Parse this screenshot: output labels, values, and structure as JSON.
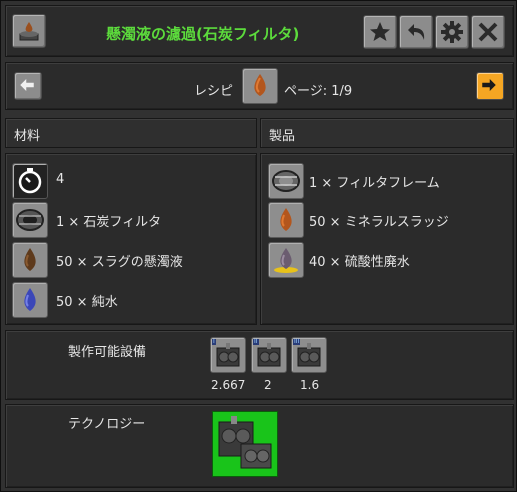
{
  "header": {
    "title": "懸濁液の濾過(石炭フィルタ)",
    "icon": "slurry-filter-recipe-icon",
    "buttons": [
      "star-icon",
      "back-icon",
      "gear-icon",
      "close-icon"
    ]
  },
  "nav": {
    "recipe_label": "レシピ",
    "page_label": "ページ: 1/9",
    "recipe_icon": "mineral-sludge-icon"
  },
  "ingredients": {
    "heading": "材料",
    "items": [
      {
        "icon": "time-icon",
        "text": "4"
      },
      {
        "icon": "coal-filter-icon",
        "text": "1 × 石炭フィルタ"
      },
      {
        "icon": "slag-slurry-icon",
        "text": "50 × スラグの懸濁液"
      },
      {
        "icon": "pure-water-icon",
        "text": "50 × 純水"
      }
    ]
  },
  "products": {
    "heading": "製品",
    "items": [
      {
        "icon": "filter-frame-icon",
        "text": "1 × フィルタフレーム"
      },
      {
        "icon": "mineral-sludge-icon",
        "text": "50 × ミネラルスラッジ"
      },
      {
        "icon": "sulfuric-waste-water-icon",
        "text": "40 × 硫酸性廃水"
      }
    ]
  },
  "machines": {
    "label": "製作可能設備",
    "items": [
      {
        "tier": "I",
        "speed": "2.667"
      },
      {
        "tier": "II",
        "speed": "2"
      },
      {
        "tier": "III",
        "speed": "1.6"
      }
    ]
  },
  "technology": {
    "label": "テクノロジー",
    "icon": "washing-plant-technology-icon"
  },
  "colors": {
    "title": "#5cdb3c",
    "accent_button": "#f5a623",
    "tech_bg": "#19c41a"
  }
}
